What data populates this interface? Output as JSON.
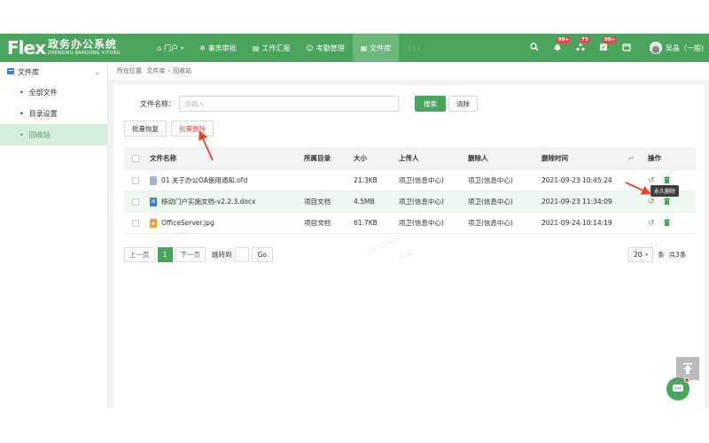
{
  "app": {
    "logo_main": "Flex",
    "logo_cn": "政务办公系统",
    "logo_en": "ZHENGWU BANGONG XITONG"
  },
  "nav": [
    {
      "label": "门户",
      "icon": "home-icon",
      "glyph": "⌂",
      "caret": "▾"
    },
    {
      "label": "事务审批",
      "icon": "gear-icon",
      "glyph": "✲"
    },
    {
      "label": "工作汇报",
      "icon": "report-icon",
      "glyph": "▤"
    },
    {
      "label": "考勤管理",
      "icon": "person-icon",
      "glyph": "☺"
    },
    {
      "label": "文件库",
      "icon": "file-library-icon",
      "glyph": "▣"
    },
    {
      "label": "",
      "icon": "grid-icon",
      "glyph": "⋮⋮⋮"
    }
  ],
  "header_right": {
    "badges": [
      "99+",
      "73",
      "99+"
    ],
    "user_name": "吴晶（一般)"
  },
  "sidebar": {
    "title": "文件库",
    "items": [
      {
        "label": "全部文件"
      },
      {
        "label": "目录设置"
      },
      {
        "label": "回收站"
      }
    ]
  },
  "breadcrumb": [
    "所在位置:",
    "文件库",
    "›",
    "回收站"
  ],
  "search": {
    "label": "文件名称：",
    "placeholder": "请输入",
    "search_button": "搜索",
    "clear_button": "清除"
  },
  "batch": {
    "restore": "批量恢复",
    "delete": "批量删除"
  },
  "table": {
    "headers": [
      "文件名称",
      "所属目录",
      "大小",
      "上传人",
      "删除人",
      "删除时间",
      "操作"
    ],
    "rows": [
      {
        "name": "01 关于办公OA使用通知.ofd",
        "dir": "",
        "size": "21.3KB",
        "uploader": "项卫(信息中心)",
        "deleter": "项卫(信息中心)",
        "time": "2021-09-23 10:45:24",
        "type": "ofd"
      },
      {
        "name": "移动门户实施文档-v2.2.3.docx",
        "dir": "项目文档",
        "size": "4.5MB",
        "uploader": "项卫(信息中心)",
        "deleter": "项卫(信息中心)",
        "time": "2021-09-23 11:34:09",
        "type": "doc"
      },
      {
        "name": "OfficeServer.jpg",
        "dir": "项目文档",
        "size": "61.7KB",
        "uploader": "项卫(信息中心)",
        "deleter": "项卫(信息中心)",
        "time": "2021-09-24 10:14:19",
        "type": "img"
      }
    ]
  },
  "tooltip": "永久删除",
  "pager": {
    "prev": "上一页",
    "current": "1",
    "next": "下一页",
    "jump": "跳转到",
    "go": "Go",
    "per_page": "20",
    "unit": "条",
    "total": "共3条"
  },
  "watermarks": [
    "20210924",
    "吴晶"
  ],
  "colors": {
    "brand": "#4aa45b",
    "danger": "#e24b4b",
    "arrow": "#e8452c"
  }
}
